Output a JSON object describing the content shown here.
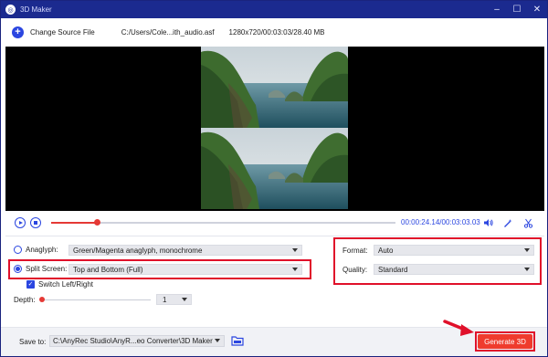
{
  "window": {
    "title": "3D Maker",
    "controls": [
      "–",
      "☐",
      "✕"
    ]
  },
  "file": {
    "add_label": "Change Source File",
    "path": "C:/Users/Cole...ith_audio.asf",
    "info": "1280x720/00:03:03/28.40 MB"
  },
  "transport": {
    "current_time": "00:00:24.14",
    "total_time": "/00:03:03.03",
    "progress": 0.132
  },
  "options": {
    "anaglyph_label": "Anaglyph:",
    "anaglyph_value": "Green/Magenta anaglyph, monochrome",
    "split_label": "Split Screen:",
    "split_value": "Top and Bottom (Full)",
    "switch_label": "Switch Left/Right",
    "depth_label": "Depth:",
    "depth_value": "1",
    "format_label": "Format:",
    "format_value": "Auto",
    "quality_label": "Quality:",
    "quality_value": "Standard"
  },
  "footer": {
    "save_label": "Save to:",
    "save_path": "C:\\AnyRec Studio\\AnyR...eo Converter\\3D Maker",
    "generate_label": "Generate 3D"
  },
  "colors": {
    "accent": "#2b46e0",
    "highlight": "#e0102a",
    "generate": "#ef3b2d"
  }
}
